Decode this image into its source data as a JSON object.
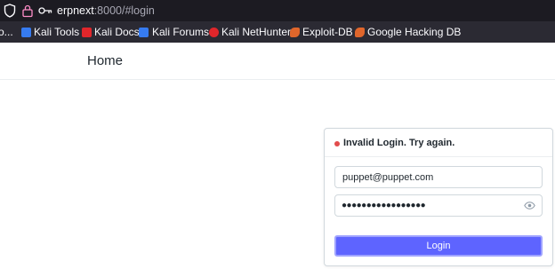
{
  "browser": {
    "url_host": "erpnext",
    "url_rest": ":8000/#login"
  },
  "bookmarks": [
    {
      "label": "Kali Tools",
      "icon": "kali-tools-icon",
      "color": "#367bf0"
    },
    {
      "label": "Kali Docs",
      "icon": "kali-docs-icon",
      "color": "#e0262b"
    },
    {
      "label": "Kali Forums",
      "icon": "kali-forums-icon",
      "color": "#367bf0"
    },
    {
      "label": "Kali NetHunter",
      "icon": "kali-nethunter-icon",
      "color": "#e0262b"
    },
    {
      "label": "Exploit-DB",
      "icon": "exploit-db-icon",
      "color": "#e0662b"
    },
    {
      "label": "Google Hacking DB",
      "icon": "google-hacking-db-icon",
      "color": "#e0662b"
    }
  ],
  "bookmark_overflow": "o...",
  "navbar": {
    "brand": "Home"
  },
  "login": {
    "error_message": "Invalid Login. Try again.",
    "email_value": "puppet@puppet.com",
    "password_mask": "●●●●●●●●●●●●●●●●●",
    "button_label": "Login",
    "accent_color": "#5e64ff",
    "error_color": "#e24c4c"
  }
}
